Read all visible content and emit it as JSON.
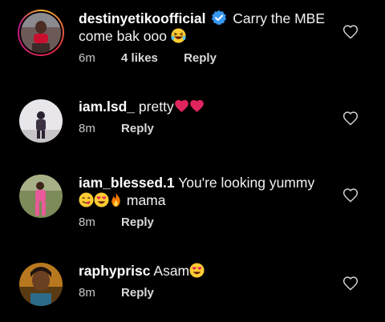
{
  "comments": [
    {
      "username": "destinyetikoofficial",
      "text_before": "Carry the MBE",
      "text_line2": "come bak ooo",
      "time": "6m",
      "likes": "4 likes",
      "reply": "Reply",
      "verified": true,
      "avatar_icon": "profile-photo-woman-red-top"
    },
    {
      "username": "iam.lsd_",
      "text": "pretty",
      "time": "8m",
      "reply": "Reply",
      "avatar_icon": "profile-photo-person-standing"
    },
    {
      "username": "iam_blessed.1",
      "text": "You're looking yummy",
      "text_line2": "mama",
      "time": "8m",
      "reply": "Reply",
      "avatar_icon": "profile-photo-woman-pink-outfit"
    },
    {
      "username": "raphyprisc",
      "text": "Asam",
      "time": "8m",
      "reply": "Reply",
      "avatar_icon": "profile-photo-woman-portrait"
    }
  ],
  "colors": {
    "background": "#000000",
    "text": "#f2f2f2",
    "meta": "#c9c9c9",
    "verified_blue": "#3897f0",
    "heart_red": "#e0245e"
  },
  "icons": {
    "like": "heart-outline-icon",
    "verified": "verified-badge-icon",
    "laugh_emoji": "grinning-squinting-face-icon",
    "heart_emoji": "red-heart-icon",
    "yum_emoji": "face-savoring-food-icon",
    "heart_eyes_emoji": "heart-eyes-face-icon",
    "fire_emoji": "fire-icon"
  }
}
